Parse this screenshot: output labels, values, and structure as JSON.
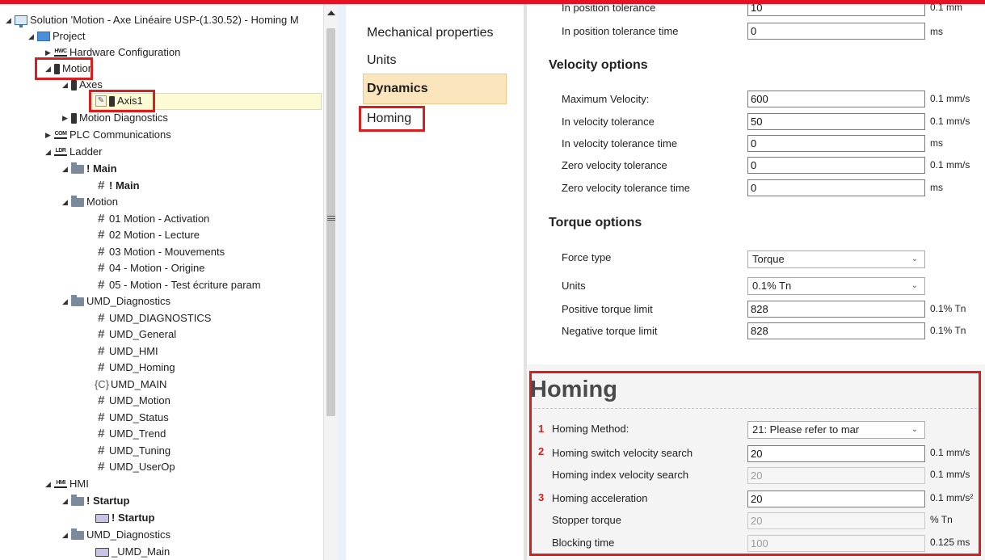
{
  "tree": {
    "solution": "Solution 'Motion - Axe Linéaire USP-(1.30.52) - Homing M",
    "project": "Project",
    "hardware_config": "Hardware Configuration",
    "motion": "Motion",
    "axes": "Axes",
    "axis1": "Axis1",
    "motion_diagnostics": "Motion Diagnostics",
    "plc_comm": "PLC Communications",
    "ladder": "Ladder",
    "main_folder": "! Main",
    "main_item": "! Main",
    "motion_folder": "Motion",
    "motion_items": [
      "01 Motion - Activation",
      "02 Motion - Lecture",
      "03 Motion - Mouvements",
      "04 - Motion - Origine",
      "05 - Motion - Test écriture param"
    ],
    "umd_folder": "UMD_Diagnostics",
    "umd_items": [
      "UMD_DIAGNOSTICS",
      "UMD_General",
      "UMD_HMI",
      "UMD_Homing",
      "UMD_MAIN",
      "UMD_Motion",
      "UMD_Status",
      "UMD_Trend",
      "UMD_Tuning",
      "UMD_UserOp"
    ],
    "hmi": "HMI",
    "startup_folder": "! Startup",
    "startup_item": "! Startup",
    "hmi_umd_folder": "UMD_Diagnostics",
    "umd_main_screen": "_UMD_Main",
    "icon_labels": {
      "hwc": "HWC",
      "com": "COM",
      "ldr": "LDR",
      "hmi": "HMI"
    }
  },
  "nav": {
    "items": [
      "Mechanical properties",
      "Units",
      "Dynamics",
      "Homing"
    ],
    "selected": "Dynamics"
  },
  "position": {
    "rows": [
      {
        "label": "In position tolerance",
        "value": "10",
        "unit": "0.1 mm"
      },
      {
        "label": "In position tolerance time",
        "value": "0",
        "unit": "ms"
      }
    ]
  },
  "velocity": {
    "title": "Velocity options",
    "rows": [
      {
        "label": "Maximum Velocity:",
        "value": "600",
        "unit": "0.1 mm/s"
      },
      {
        "label": "In velocity tolerance",
        "value": "50",
        "unit": "0.1 mm/s"
      },
      {
        "label": "In velocity tolerance time",
        "value": "0",
        "unit": "ms"
      },
      {
        "label": "Zero velocity tolerance",
        "value": "0",
        "unit": "0.1 mm/s"
      },
      {
        "label": "Zero velocity tolerance time",
        "value": "0",
        "unit": "ms"
      }
    ]
  },
  "torque": {
    "title": "Torque options",
    "force_type_label": "Force type",
    "force_type_value": "Torque",
    "units_label": "Units",
    "units_value": "0.1% Tn",
    "rows": [
      {
        "label": "Positive torque limit",
        "value": "828",
        "unit": "0.1% Tn"
      },
      {
        "label": "Negative torque limit",
        "value": "828",
        "unit": "0.1% Tn"
      }
    ]
  },
  "homing": {
    "title": "Homing",
    "method_label": "Homing Method:",
    "method_value": "21: Please refer to mar",
    "markers": [
      "1",
      "2",
      "3"
    ],
    "rows": [
      {
        "label": "Homing switch velocity search",
        "value": "20",
        "unit": "0.1 mm/s"
      },
      {
        "label": "Homing index velocity search",
        "value": "20",
        "unit": "0.1 mm/s"
      },
      {
        "label": "Homing acceleration",
        "value": "20",
        "unit": "0.1 mm/s²"
      },
      {
        "label": "Stopper torque",
        "value": "20",
        "unit": "% Tn"
      },
      {
        "label": "Blocking time",
        "value": "100",
        "unit": "0.125 ms"
      }
    ]
  },
  "colors": {
    "highlight": "#d81e1e",
    "selected_nav": "#fbe5bd",
    "selected_row": "#fdfbd3"
  }
}
